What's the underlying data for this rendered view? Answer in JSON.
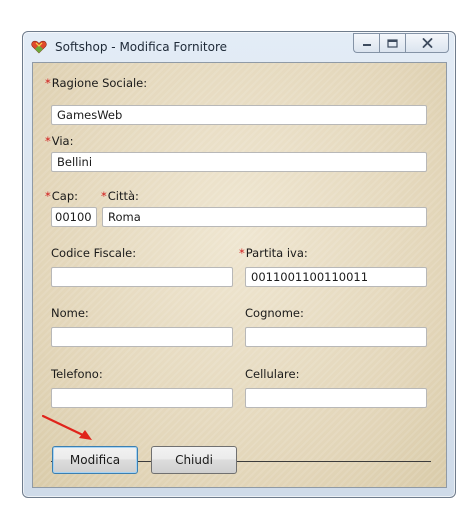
{
  "window": {
    "title": "Softshop - Modifica Fornitore"
  },
  "form": {
    "ragione_sociale": {
      "required_mark": "*",
      "label": "Ragione Sociale:",
      "value": "GamesWeb"
    },
    "via": {
      "required_mark": "*",
      "label": "Via:",
      "value": "Bellini"
    },
    "cap": {
      "required_mark": "*",
      "label": "Cap:",
      "value": "00100"
    },
    "citta": {
      "required_mark": "*",
      "label": "Città:",
      "value": "Roma"
    },
    "codice_fiscale": {
      "label": "Codice Fiscale:",
      "value": ""
    },
    "partita_iva": {
      "required_mark": "*",
      "label": "Partita iva:",
      "value": "0011001100110011"
    },
    "nome": {
      "label": "Nome:",
      "value": ""
    },
    "cognome": {
      "label": "Cognome:",
      "value": ""
    },
    "telefono": {
      "label": "Telefono:",
      "value": ""
    },
    "cellulare": {
      "label": "Cellulare:",
      "value": ""
    }
  },
  "buttons": {
    "modifica": "Modifica",
    "chiudi": "Chiudi"
  },
  "colors": {
    "required_asterisk": "#d11818",
    "annotation_arrow": "#e0241b",
    "panel_background": "#e7dcc3"
  },
  "icons": {
    "app": "heart-shield-icon",
    "minimize": "minimize-icon",
    "maximize": "maximize-icon",
    "close": "close-icon"
  }
}
